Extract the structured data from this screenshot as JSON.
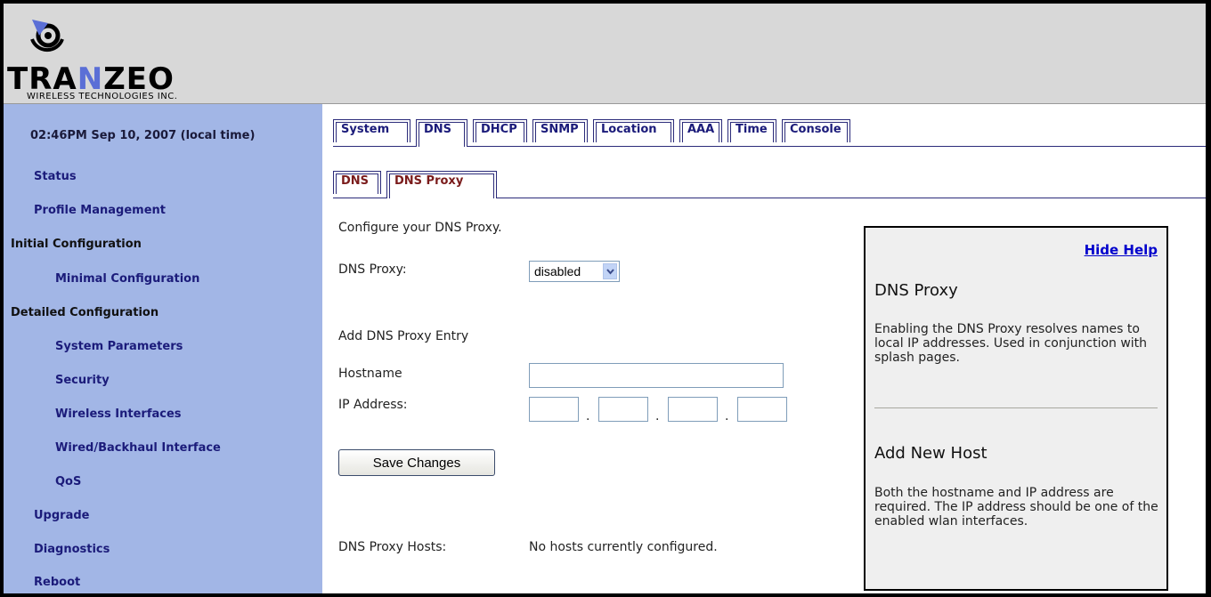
{
  "brand": {
    "name_before": "TRA",
    "name_accent": "N",
    "name_after": "ZEO",
    "tagline": "WIRELESS TECHNOLOGIES INC.",
    "accent_color": "#5b6fd6"
  },
  "sidebar": {
    "datetime": "02:46PM Sep 10, 2007 (local time)",
    "items": [
      {
        "label": "Status"
      },
      {
        "label": "Profile Management"
      },
      {
        "label": "Initial Configuration"
      },
      {
        "label": "Minimal Configuration"
      },
      {
        "label": "Detailed Configuration"
      },
      {
        "label": "System Parameters"
      },
      {
        "label": "Security"
      },
      {
        "label": "Wireless Interfaces"
      },
      {
        "label": "Wired/Backhaul Interface"
      },
      {
        "label": "QoS"
      },
      {
        "label": "Upgrade"
      },
      {
        "label": "Diagnostics"
      },
      {
        "label": "Reboot"
      }
    ]
  },
  "tabs": [
    "System",
    "DNS",
    "DHCP",
    "SNMP",
    "Location",
    "AAA",
    "Time",
    "Console"
  ],
  "active_tab": "DNS",
  "subtabs": [
    "DNS",
    "DNS Proxy"
  ],
  "active_subtab": "DNS Proxy",
  "form": {
    "intro": "Configure your DNS Proxy.",
    "proxy_label": "DNS Proxy:",
    "proxy_value": "disabled",
    "add_heading": "Add DNS Proxy Entry",
    "hostname_label": "Hostname",
    "hostname_value": "",
    "ip_label": "IP Address:",
    "ip_octets": [
      "",
      "",
      "",
      ""
    ],
    "ip_separator": ".",
    "save_label": "Save Changes",
    "hosts_label": "DNS Proxy Hosts:",
    "hosts_value": "No hosts currently configured."
  },
  "help": {
    "hide_label": "Hide Help",
    "title1": "DNS Proxy",
    "text1": "Enabling the DNS Proxy resolves names to local IP addresses. Used in conjunction with splash pages.",
    "title2": "Add New Host",
    "text2": "Both the hostname and IP address are required. The IP address should be one of the enabled wlan interfaces."
  }
}
